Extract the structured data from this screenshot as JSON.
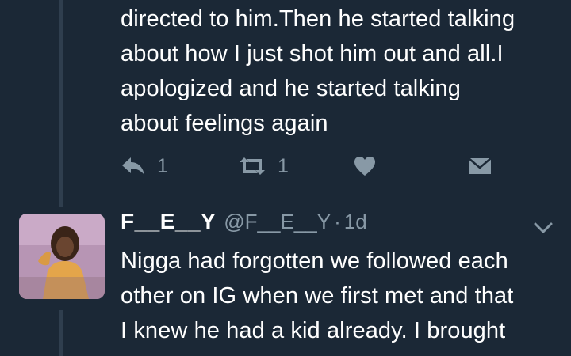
{
  "tweet1": {
    "text": "directed to him.Then he started talking\nabout how I just shot him out and all.I\napologized and he started talking\nabout feelings again",
    "actions": {
      "reply_count": "1",
      "retweet_count": "1"
    }
  },
  "tweet2": {
    "display_name": "F__E__Y",
    "handle": "@F__E__Y",
    "separator": "·",
    "timestamp": "1d",
    "text": "Nigga had forgotten we followed each\nother on IG when we first met and that\nI knew he had a kid already. I brought"
  },
  "colors": {
    "background": "#1b2836",
    "thread_line": "#2f3e4e",
    "primary_text": "#ffffff",
    "secondary_text": "#8899a6"
  },
  "icons": [
    "reply-icon",
    "retweet-icon",
    "like-icon",
    "message-icon",
    "chevron-down-icon"
  ]
}
